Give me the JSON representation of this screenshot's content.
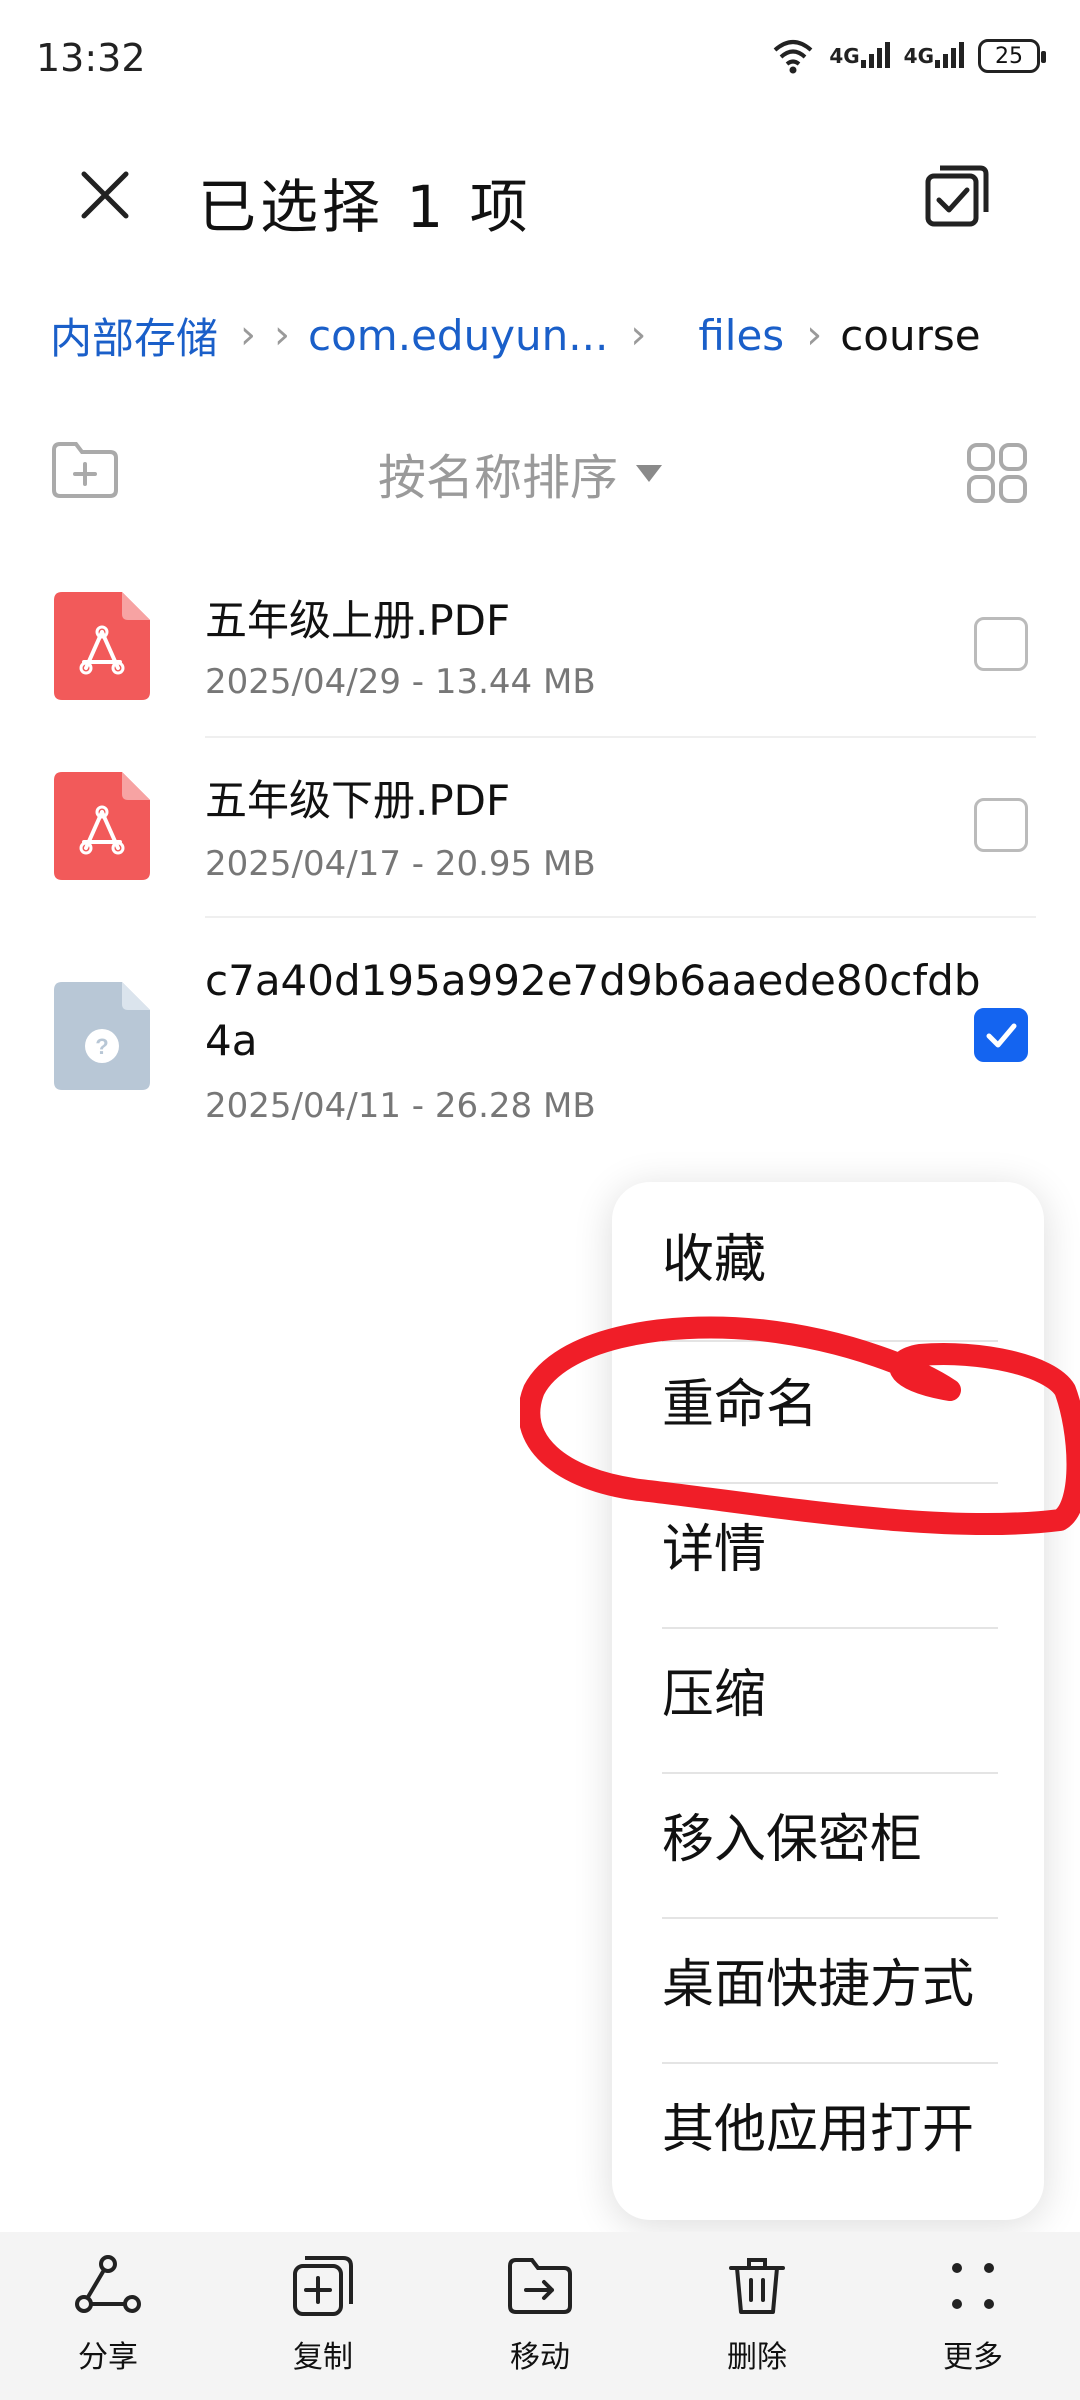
{
  "status_bar": {
    "time": "13:32",
    "network_1": "4G",
    "network_2": "4G",
    "battery": "25"
  },
  "header": {
    "title": "已选择 1 项",
    "close_icon": "close-icon",
    "select_all_icon": "select-all-icon"
  },
  "breadcrumb": {
    "items": [
      "内部存储",
      "com.eduyun...",
      "files",
      "course"
    ]
  },
  "sort_bar": {
    "label": "按名称排序",
    "new_folder_icon": "new-folder-icon",
    "view_icon": "grid-view-icon"
  },
  "files": [
    {
      "name": "五年级上册.PDF",
      "meta": "2025/04/29 - 13.44 MB",
      "type": "pdf",
      "checked": false
    },
    {
      "name": "五年级下册.PDF",
      "meta": "2025/04/17 - 20.95 MB",
      "type": "pdf",
      "checked": false
    },
    {
      "name_line1": "c7a40d195a992e7d9b6aaede80cfdb",
      "name_line2": "4a",
      "meta": "2025/04/11 - 26.28 MB",
      "type": "unknown",
      "checked": true
    }
  ],
  "menu": {
    "items": [
      "收藏",
      "重命名",
      "详情",
      "压缩",
      "移入保密柜",
      "桌面快捷方式",
      "其他应用打开"
    ]
  },
  "toolbar": {
    "items": [
      {
        "label": "分享",
        "icon": "share-icon"
      },
      {
        "label": "复制",
        "icon": "copy-icon"
      },
      {
        "label": "移动",
        "icon": "move-icon"
      },
      {
        "label": "删除",
        "icon": "delete-icon"
      },
      {
        "label": "更多",
        "icon": "more-icon"
      }
    ]
  },
  "colors": {
    "accent": "#1464f0",
    "link": "#1a5fc9",
    "pdf": "#f25a5a",
    "unknown_file": "#b8c7d6",
    "annotation": "#f01e28"
  }
}
